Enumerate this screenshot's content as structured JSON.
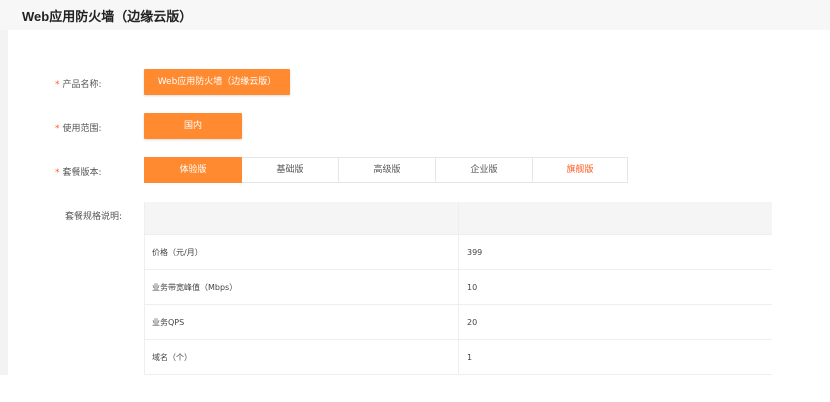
{
  "page": {
    "title": "Web应用防火墙（边缘云版）"
  },
  "form": {
    "product_name": {
      "label": "产品名称:",
      "value": "Web应用防火墙（边缘云版）"
    },
    "scope": {
      "label": "使用范围:",
      "value": "国内"
    },
    "package": {
      "label": "套餐版本:",
      "tabs": [
        "体验版",
        "基础版",
        "高级版",
        "企业版",
        "旗舰版"
      ],
      "selected": "体验版"
    },
    "spec": {
      "label": "套餐规格说明:",
      "rows": [
        {
          "name": "价格（元/月）",
          "value": "399"
        },
        {
          "name": "业务带宽峰值（Mbps）",
          "value": "10"
        },
        {
          "name": "业务QPS",
          "value": "20"
        },
        {
          "name": "域名（个）",
          "value": "1"
        }
      ]
    }
  },
  "colors": {
    "accent": "#ff8a30",
    "required": "#ff5a1f"
  }
}
